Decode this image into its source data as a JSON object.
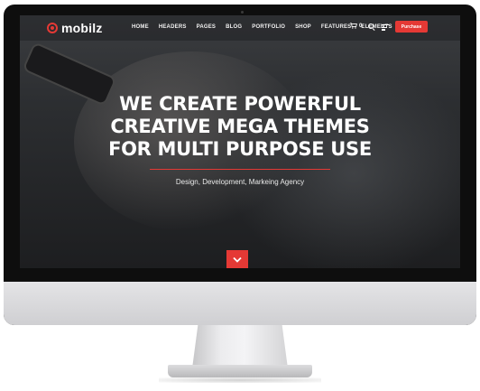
{
  "site": {
    "logo_text": "mobilz",
    "nav": [
      "HOME",
      "HEADERS",
      "PAGES",
      "BLOG",
      "PORTFOLIO",
      "SHOP",
      "FEATURES",
      "ELEMENTS"
    ],
    "cart_count": "0",
    "purchase_label": "Purchase"
  },
  "hero": {
    "line1": "WE CREATE POWERFUL",
    "line2": "CREATIVE MEGA THEMES",
    "line3": "FOR MULTI PURPOSE USE",
    "subtitle": "Design, Development, Markeing Agency"
  },
  "colors": {
    "accent": "#e53935",
    "monitor_frame": "#0e0e0e",
    "stand": "#d4d4d6"
  },
  "icons": {
    "logo": "logo-ring-icon",
    "cart": "cart-icon",
    "search": "search-icon",
    "menu": "hamburger-icon",
    "scroll": "chevron-down-icon"
  }
}
